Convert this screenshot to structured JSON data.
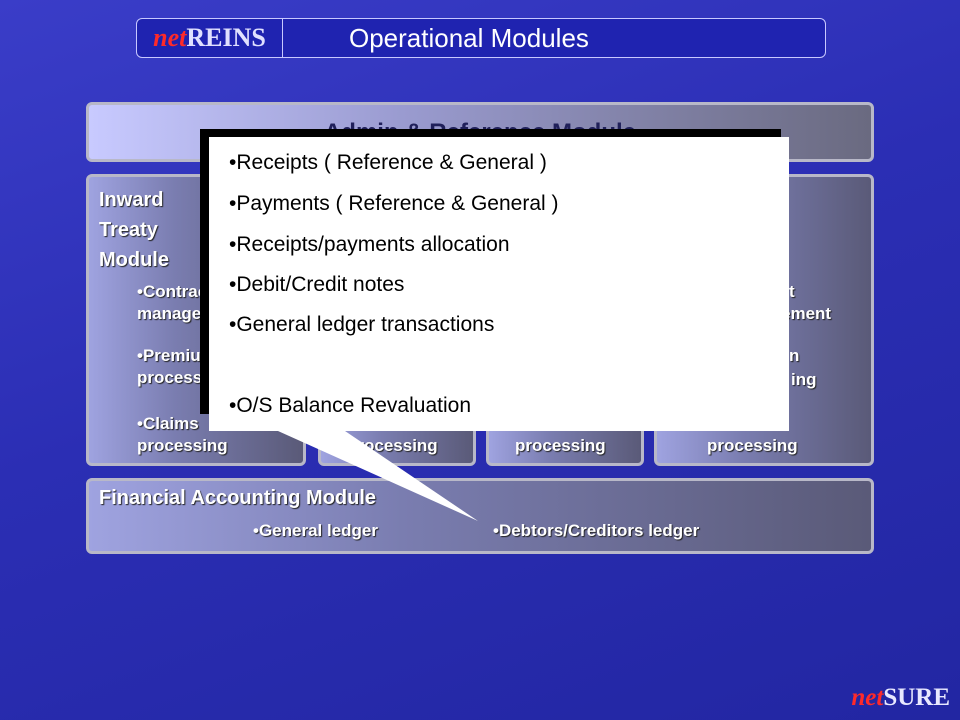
{
  "header": {
    "logo_prefix": "net",
    "logo_brand": "REINS",
    "title": "Operational Modules"
  },
  "admin_module": {
    "title": "Admin & Reference Module"
  },
  "modules": [
    {
      "title_lines": [
        "Inward",
        "Treaty",
        "Module"
      ],
      "items": [
        {
          "line1": "•Contract",
          "line2": "management"
        },
        {
          "line1": "•Premium",
          "line2": "processing"
        },
        {
          "line1": "•Claims",
          "line2": "processing"
        }
      ]
    },
    {
      "items": [
        {
          "line2": "processing"
        }
      ]
    },
    {
      "items": [
        {
          "line2": "processing"
        }
      ]
    },
    {
      "items": [
        {
          "line1": "t",
          "line2": "ement"
        },
        {
          "line1": "n",
          "line2": "ing"
        },
        {
          "line2": "processing"
        }
      ]
    }
  ],
  "financial_module": {
    "title": "Financial Accounting Module",
    "items": [
      "•General ledger",
      "•Debtors/Creditors ledger"
    ]
  },
  "callout": {
    "lines": [
      "•Receipts ( Reference & General )",
      "•Payments ( Reference & General )",
      "•Receipts/payments allocation",
      "•Debit/Credit notes",
      "•General ledger transactions",
      "•O/S Balance Revaluation"
    ]
  },
  "footer": {
    "logo_prefix": "net",
    "logo_brand": "SURE"
  },
  "colors": {
    "background": "#2b2eb4",
    "logo_accent": "#ff2a2a",
    "panel_border": "#b8b8c8",
    "callout_bg": "#ffffff"
  }
}
